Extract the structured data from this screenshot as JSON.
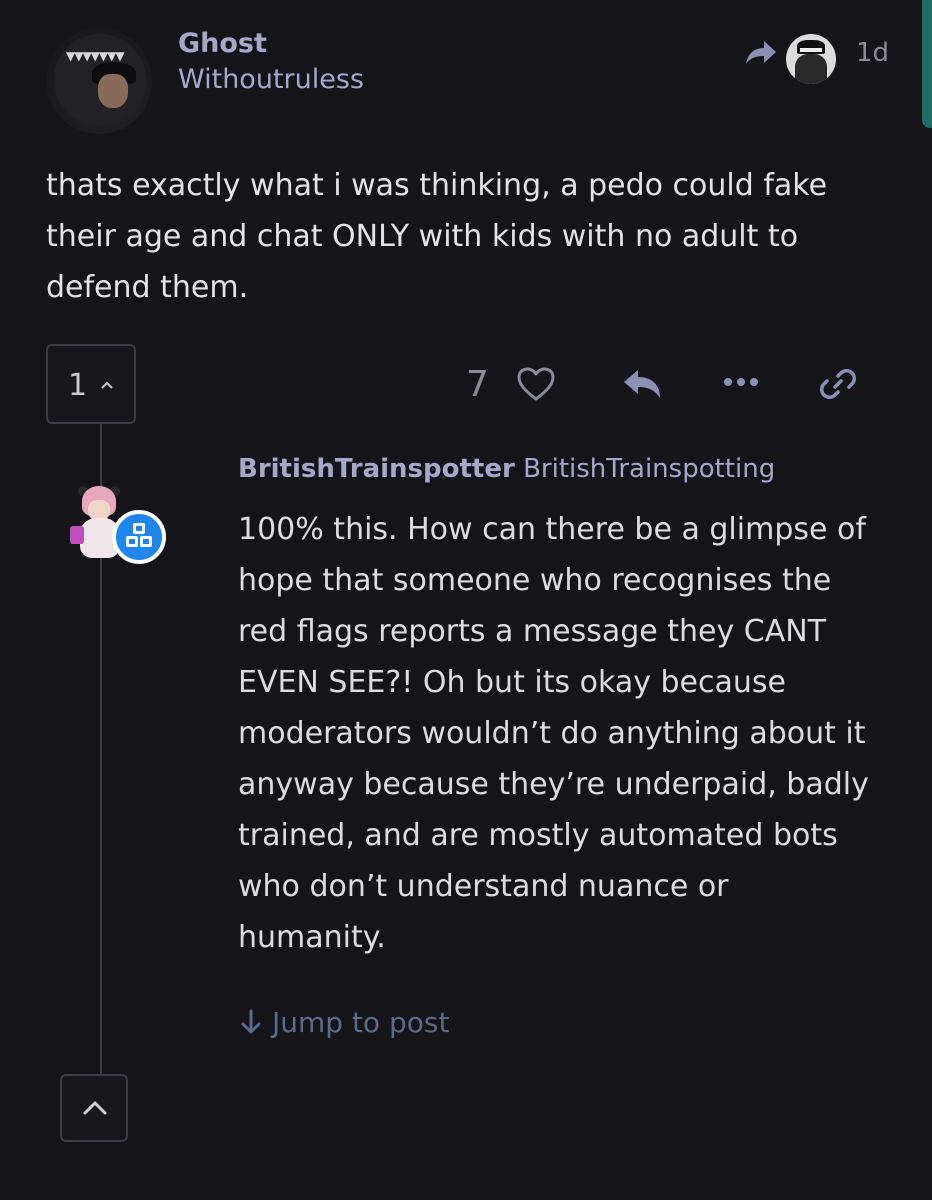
{
  "post": {
    "display_name": "Ghost",
    "username": "Withoutruless",
    "time": "1d",
    "body": "thats exactly what i was thinking, a pedo could fake their age and chat ONLY with kids with no adult to defend them.",
    "reply_count": "1",
    "like_count": "7"
  },
  "reply": {
    "display_name": "BritishTrainspotter",
    "username": "BritishTrainspotting",
    "body": "100% this. How can there be a glimpse of hope that someone who recognises the red flags reports a message they CANT EVEN SEE?! Oh but its okay because moderators wouldn’t do anything about it anyway because they’re underpaid, badly trained, and are mostly automated bots who don’t understand nuance or humanity.",
    "jump_label": "Jump to post"
  },
  "icons": {
    "reply_to": "share-arrow-icon",
    "like": "heart-icon",
    "reply": "reply-icon",
    "more": "ellipsis-icon",
    "link": "link-icon",
    "badge": "cubes-badge-icon",
    "jump": "arrow-down-icon",
    "collapse": "chevron-up-icon"
  },
  "colors": {
    "background": "#141419",
    "username": "#a9a7c9",
    "muted": "#8b8b95",
    "link": "#5e6a8a",
    "badge": "#1f86ee",
    "accent": "#1f6f62"
  }
}
